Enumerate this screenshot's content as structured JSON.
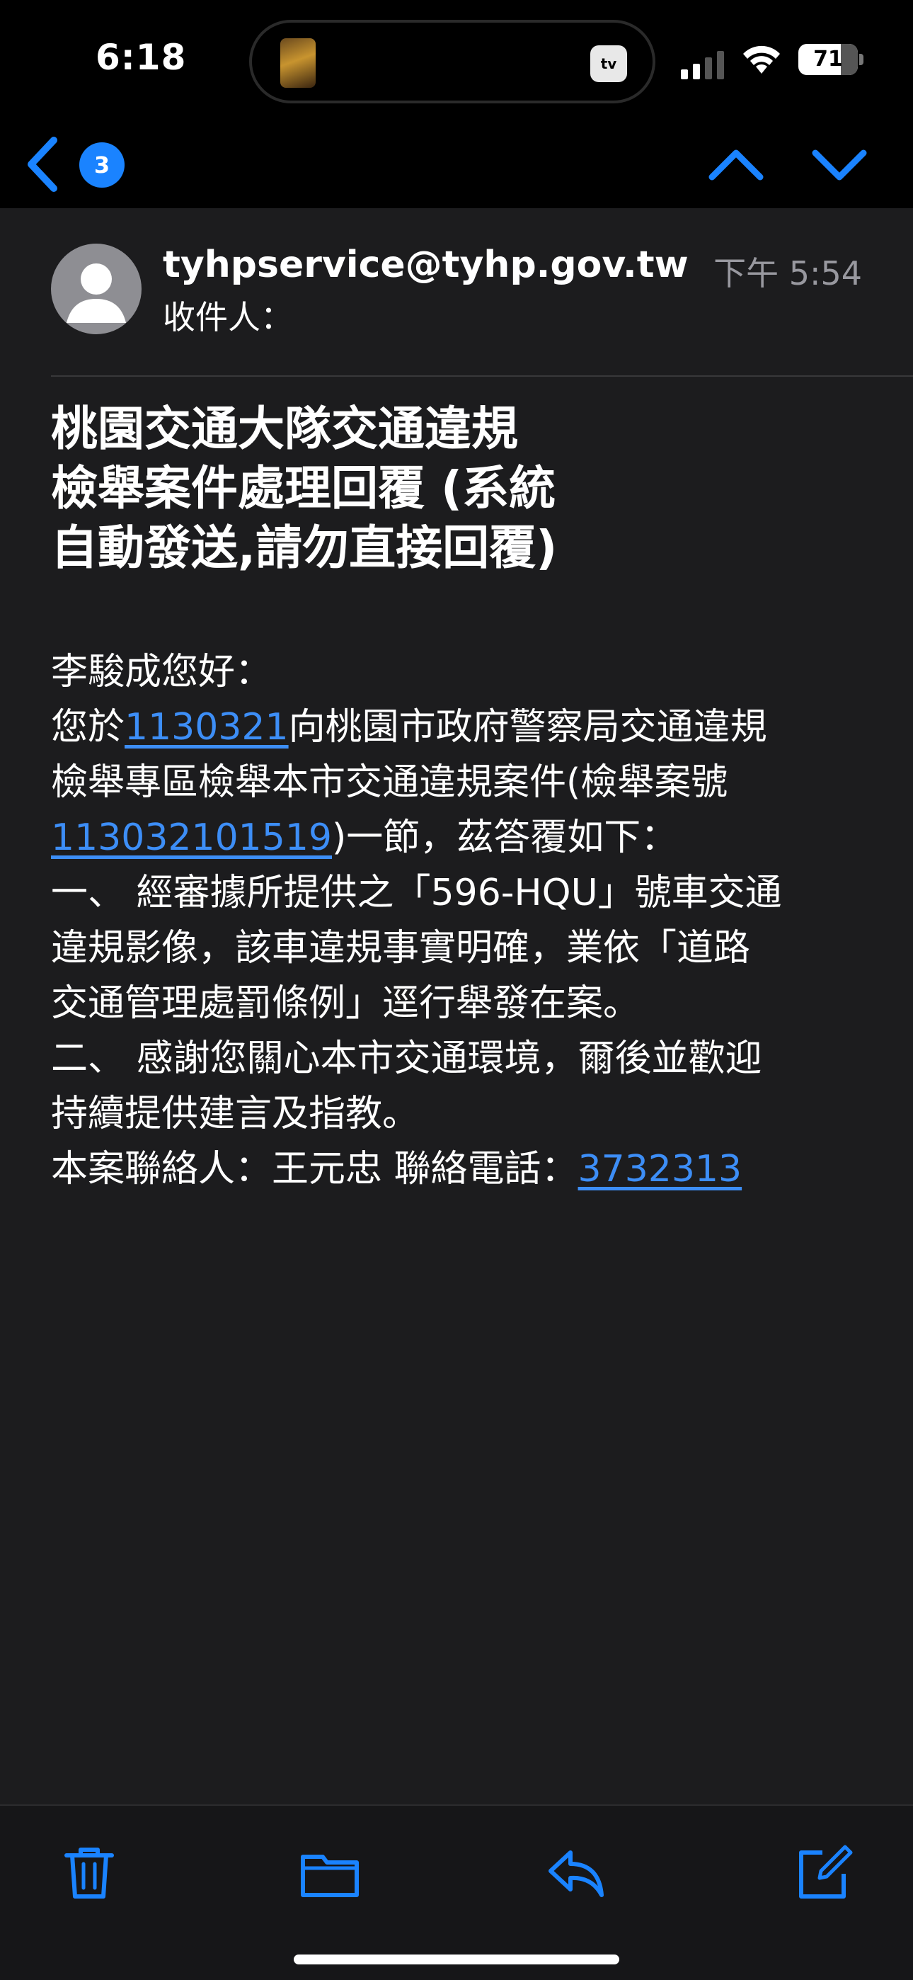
{
  "status_bar": {
    "time": "6:18",
    "battery": "71",
    "battery_level": 0.71,
    "live_activity_app_label": "tv"
  },
  "nav": {
    "unread_count": "3",
    "icons": [
      "chevron-left-icon",
      "chevron-up-icon",
      "chevron-down-icon"
    ]
  },
  "message": {
    "sender": "tyhpservice@tyhp.gov.tw",
    "recipient_label": "收件人：",
    "time": "下午 5:54",
    "subject_lines": [
      "桃園交通大隊交通違規",
      "檢舉案件處理回覆 (系統",
      "自動發送,請勿直接回覆)"
    ],
    "body": {
      "greeting": "李駿成您好：",
      "line1_prefix": "您於",
      "line1_date": "1130321",
      "line1_suffix": "向桃園市政府警察局交通違規",
      "line2": "檢舉專區檢舉本市交通違規案件(檢舉案號",
      "line3_case_no": "113032101519",
      "line3_suffix": ")一節，茲答覆如下：",
      "line4": "一、 經審據所提供之「596-HQU」號車交通",
      "line5": "違規影像，該車違規事實明確，業依「道路",
      "line6": "交通管理處罰條例」逕行舉發在案。",
      "line7": "二、 感謝您關心本市交通環境，爾後並歡迎",
      "line8": "持續提供建言及指教。",
      "line9_prefix": "本案聯絡人：王元忠 聯絡電話：",
      "line9_phone": "3732313"
    }
  },
  "toolbar": {
    "icons": [
      "trash-icon",
      "folder-icon",
      "reply-icon",
      "compose-icon"
    ]
  },
  "colors": {
    "accent": "#1a83ff",
    "link": "#3d8ef7",
    "background": "#1c1c1e",
    "secondary_text": "#98989f"
  }
}
